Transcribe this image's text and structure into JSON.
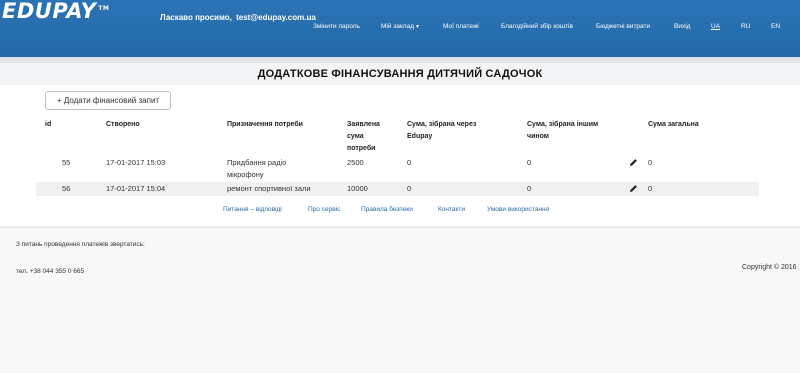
{
  "header": {
    "logo": "EDUPAY",
    "logo_tm": "TM",
    "welcome_text": "Ласкаво просимо,",
    "user_email": "test@edupay.com.ua",
    "nav": {
      "change_password": "Змінити пароль",
      "my_institution": "Мій заклад",
      "my_payments": "Мої платежі",
      "charity": "Благодійний збір коштів",
      "budget": "Бюджетні витрати",
      "logout": "Вихід"
    },
    "languages": {
      "ua": "UA",
      "ru": "RU",
      "en": "EN"
    },
    "active_language": "UA"
  },
  "page": {
    "title": "ДОДАТКОВЕ ФІНАНСУВАННЯ ДИТЯЧИЙ САДОЧОК",
    "add_button": "+ Додати фінансовий запит"
  },
  "table": {
    "headers": {
      "id": "id",
      "created": "Створено",
      "purpose": "Призначення потреби",
      "declared_l1": "Заявлена",
      "declared_l2": "сума",
      "declared_l3": "потреби",
      "edupay_l1": "Сума, зібрана через",
      "edupay_l2": "Edupay",
      "other_l1": "Сума, зібрана іншим",
      "other_l2": "чином",
      "total": "Сума загальна"
    },
    "rows": [
      {
        "id": "55",
        "created": "17-01-2017 15:03",
        "purpose_l1": "Придбання радіо",
        "purpose_l2": "мікрофону",
        "declared": "2500",
        "edupay": "0",
        "other": "0",
        "total": "0"
      },
      {
        "id": "56",
        "created": "17-01-2017 15:04",
        "purpose_l1": "ремонт спортивної зали",
        "purpose_l2": "",
        "declared": "10000",
        "edupay": "0",
        "other": "0",
        "total": "0"
      }
    ]
  },
  "footer": {
    "links": {
      "faq": "Питання – відповіді",
      "about": "Про сервіс",
      "security": "Правила безпеки",
      "contacts": "Контакти",
      "terms": "Умови використання"
    },
    "contact_note": "З питань проведення платежів звертатись:",
    "phone": "тел. +38 044 355 0 665",
    "copyright": "Copyright © 2016"
  },
  "colors": {
    "header_bg": "#2a73b5",
    "link": "#2a6aa8"
  }
}
